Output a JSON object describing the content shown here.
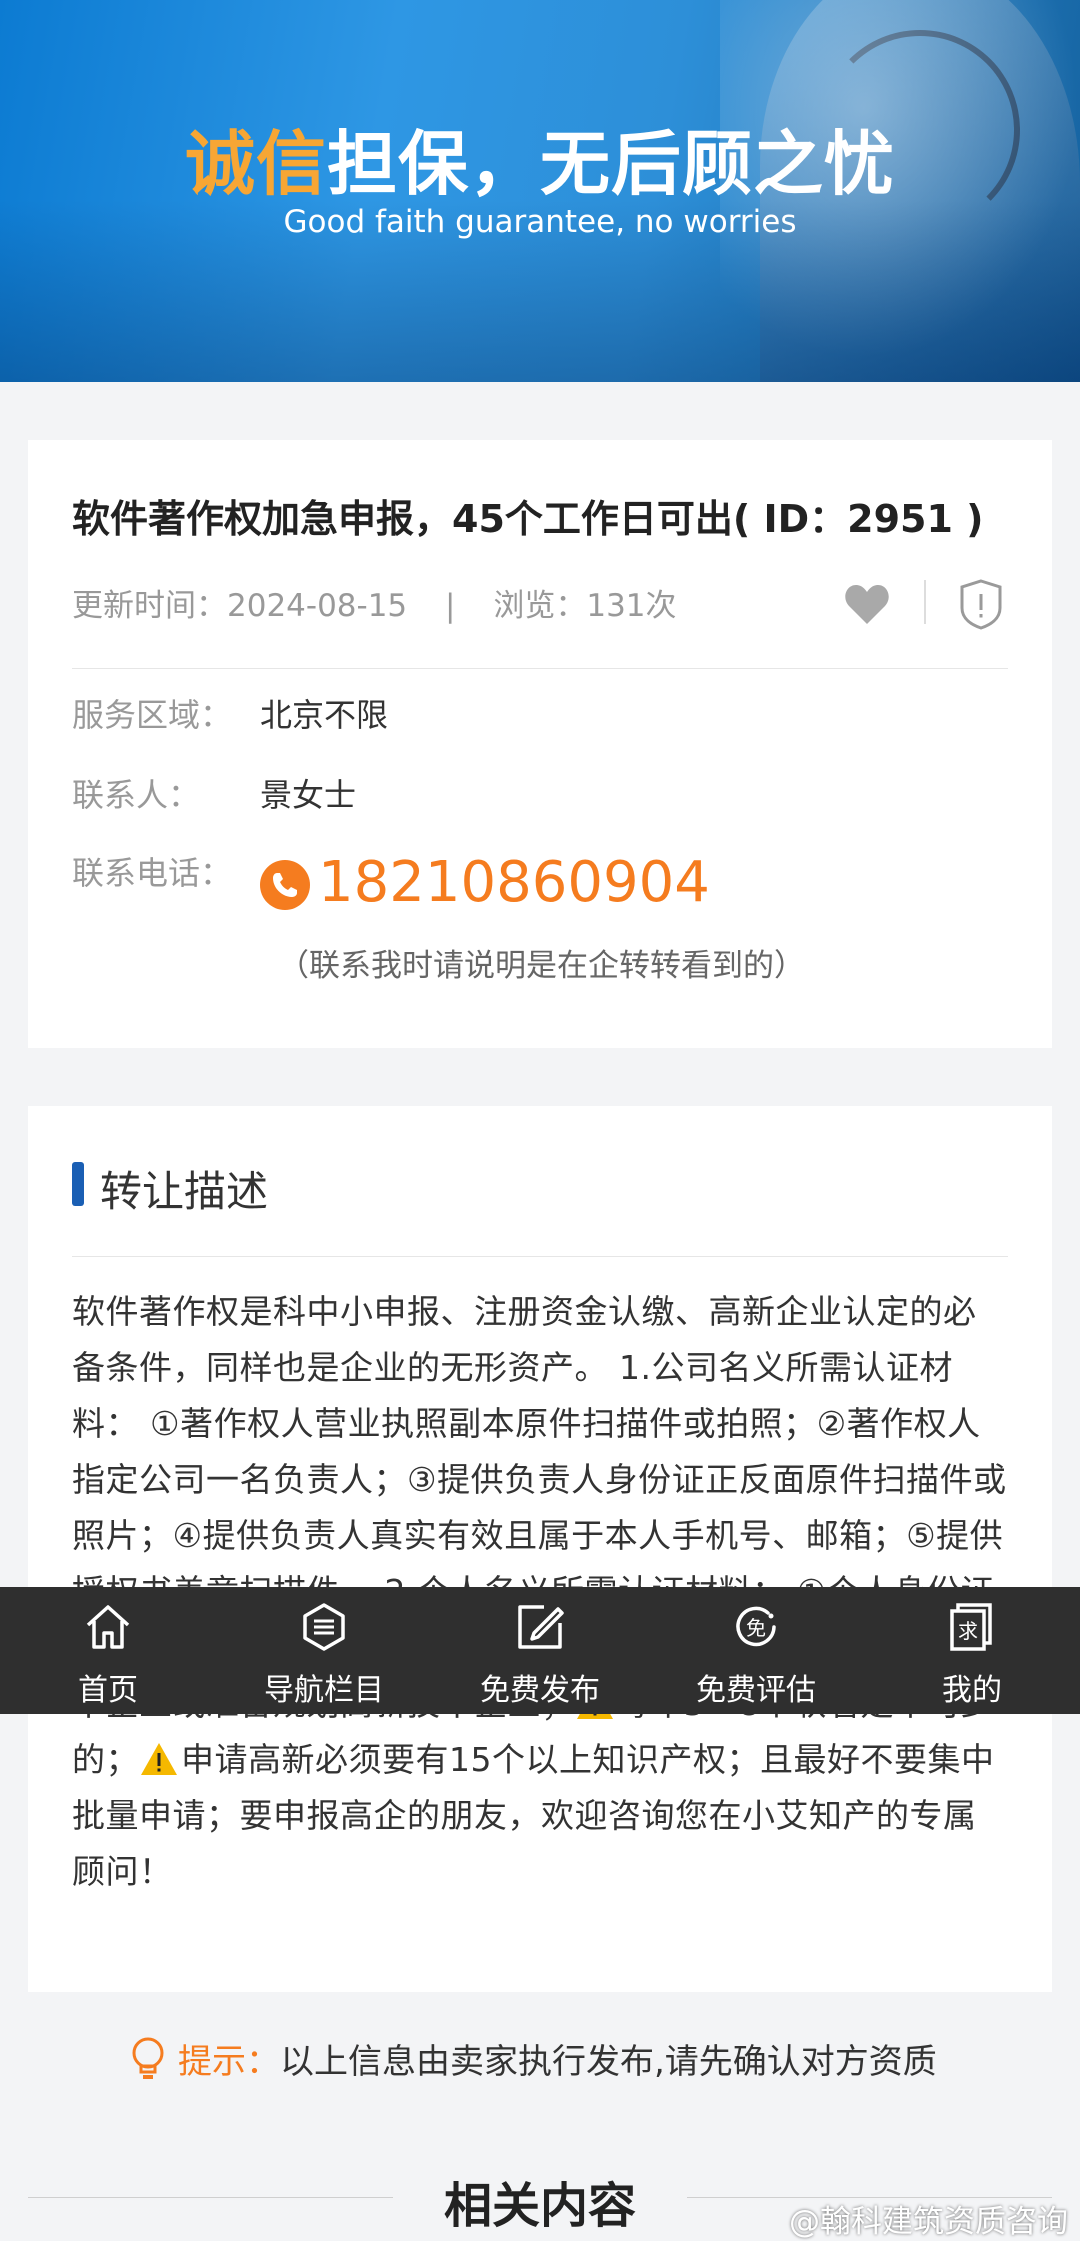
{
  "banner": {
    "title_highlight": "诚信",
    "title_rest": "担保，无后顾之忧",
    "subtitle": "Good faith guarantee, no worries"
  },
  "listing": {
    "title": "软件著作权加急申报，45个工作日可出( ID：2951 )",
    "update_label": "更新时间：",
    "update_date": "2024-08-15",
    "views_label": "浏览：",
    "views": "131次",
    "fields": {
      "region_label": "服务区域：",
      "region": "北京不限",
      "contact_label": "联系人：",
      "contact": "景女士",
      "phone_label": "联系电话：",
      "phone": "18210860904",
      "phone_note": "（联系我时请说明是在企转转看到的）"
    }
  },
  "description": {
    "section_title": "转让描述",
    "text_a": "软件著作权是科中小申报、注册资金认缴、高新企业认定的必备条件，同样也是企业的无形资产。 1.公司名义所需认证材料： ①著作权人营业执照副本原件扫描件或拍照；②著作权人指定公司一名负责人；③提供负责人身份证正反面原件扫描件或照片；④提供负责人真实有效且属于本人手机号、邮箱；⑤提供授权书盖章扫描件。 2.个人名义所需认证材料： ①个人身份证正反面扫描件或照片；②提供本人手机号、邮箱，如果是高新技术企业或准备规划高新技术企业；",
    "text_b": "每年5－8个软著是不可少的；",
    "text_c": "申请高新必须要有15个以上知识产权；且最好不要集中批量申请；要申报高企的朋友，欢迎咨询您在小艾知产的专属顾问！"
  },
  "tip": {
    "label": "提示：",
    "text": "以上信息由卖家执行发布,请先确认对方资质"
  },
  "related": {
    "title": "相关内容"
  },
  "watermark": "@翰科建筑资质咨询",
  "nav": {
    "items": [
      {
        "label": "首页",
        "icon": "home-icon"
      },
      {
        "label": "导航栏目",
        "icon": "list-icon"
      },
      {
        "label": "免费发布",
        "icon": "edit-icon"
      },
      {
        "label": "免费评估",
        "icon": "free-icon"
      },
      {
        "label": "我的",
        "icon": "user-icon"
      }
    ]
  },
  "colors": {
    "accent": "#f57c1f",
    "banner_blue": "#2e97e4",
    "section_bar": "#1a5fb4",
    "nav_bg": "#2f2f2f"
  }
}
